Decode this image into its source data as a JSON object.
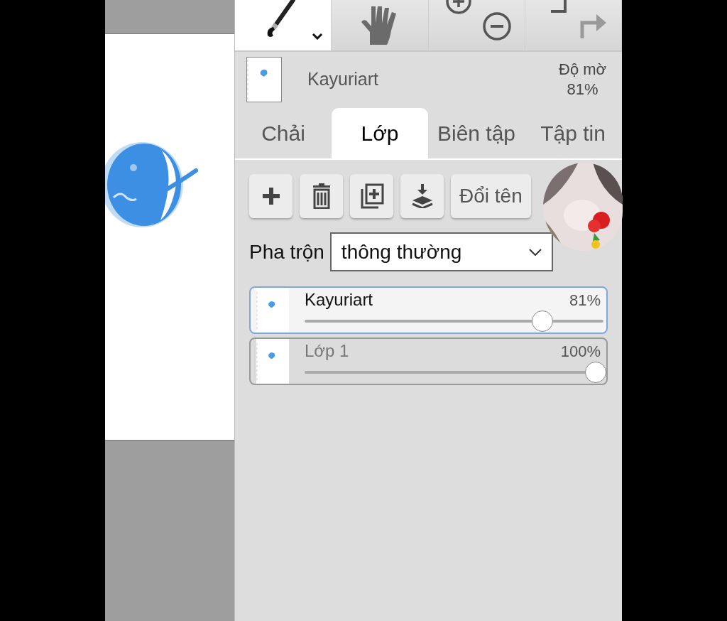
{
  "toolbar": [
    {
      "kind": "brush",
      "selected": true
    },
    {
      "kind": "hand",
      "selected": false
    },
    {
      "kind": "zoom",
      "selected": false
    },
    {
      "kind": "undo",
      "selected": false
    }
  ],
  "current_layer": {
    "name": "Kayuriart",
    "opacity_label": "Độ mờ",
    "opacity_value": "81%"
  },
  "tabs": [
    {
      "label": "Chải",
      "selected": false
    },
    {
      "label": "Lớp",
      "selected": true
    },
    {
      "label": "Biên tập",
      "selected": false
    },
    {
      "label": "Tập tin",
      "selected": false
    }
  ],
  "actions": [
    {
      "kind": "add"
    },
    {
      "kind": "delete"
    },
    {
      "kind": "duplicate"
    },
    {
      "kind": "merge"
    },
    {
      "kind": "text",
      "label": "Đổi tên"
    }
  ],
  "blend": {
    "label": "Pha trộn",
    "value": "thông thường"
  },
  "layers": [
    {
      "name": "Kayuriart",
      "opacity": "81%",
      "level": 0.81,
      "selected": true
    },
    {
      "name": "Lớp 1",
      "opacity": "100%",
      "level": 1,
      "selected": false
    }
  ]
}
